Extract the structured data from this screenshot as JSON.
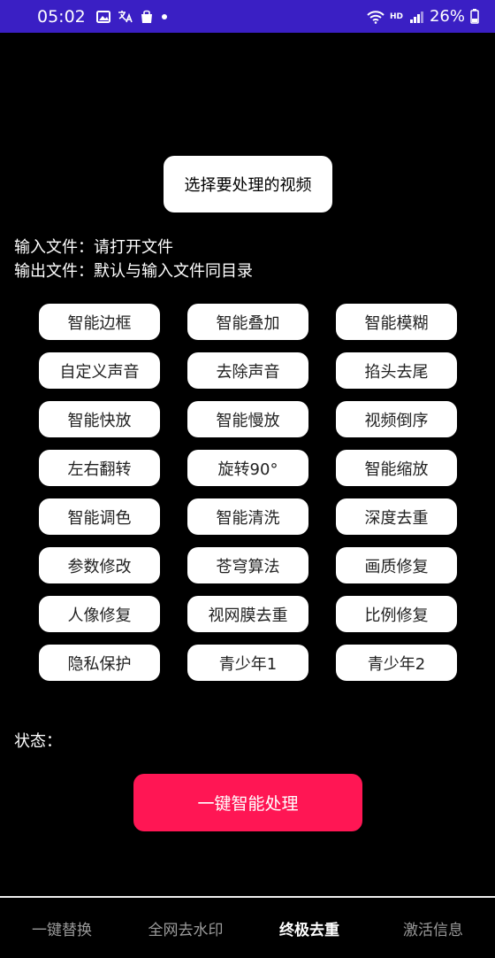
{
  "status_bar": {
    "time": "05:02",
    "left_icons": [
      "gallery-icon",
      "translate-icon",
      "shopping-bag-icon",
      "dot-icon"
    ],
    "network_label": "HD",
    "battery_percent": "26%"
  },
  "choose_button": "选择要处理的视频",
  "input_file": "输入文件：请打开文件",
  "output_file": "输出文件：默认与输入文件同目录",
  "function_rows": [
    [
      "智能边框",
      "智能叠加",
      "智能模糊"
    ],
    [
      "自定义声音",
      "去除声音",
      "掐头去尾"
    ],
    [
      "智能快放",
      "智能慢放",
      "视频倒序"
    ],
    [
      "左右翻转",
      "旋转90°",
      "智能缩放"
    ],
    [
      "智能调色",
      "智能清洗",
      "深度去重"
    ],
    [
      "参数修改",
      "苍穹算法",
      "画质修复"
    ],
    [
      "人像修复",
      "视网膜去重",
      "比例修复"
    ],
    [
      "隐私保护",
      "青少年1",
      "青少年2"
    ]
  ],
  "status_label": "状态：",
  "main_button": "一键智能处理",
  "bottom_nav": [
    "一键替换",
    "全网去水印",
    "终极去重",
    "激活信息"
  ],
  "active_tab_index": 2,
  "colors": {
    "status_bar": "#3a1fc4",
    "accent": "#ff1654",
    "background": "#000000"
  }
}
